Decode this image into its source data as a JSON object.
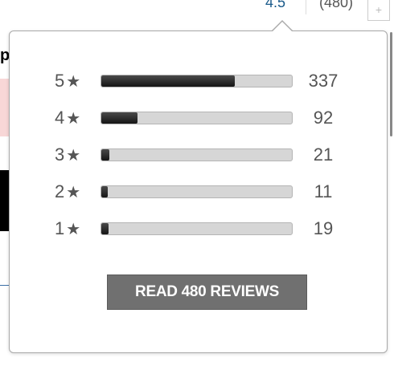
{
  "header": {
    "rating": "4.5",
    "review_count": "(480)",
    "plus_icon": "plus-icon"
  },
  "background": {
    "fragment_letter": "p"
  },
  "histogram": {
    "star_glyph": "★",
    "rows": [
      {
        "stars": "5",
        "count": "337",
        "fraction": 0.7021
      },
      {
        "stars": "4",
        "count": "92",
        "fraction": 0.1917
      },
      {
        "stars": "3",
        "count": "21",
        "fraction": 0.0438
      },
      {
        "stars": "2",
        "count": "11",
        "fraction": 0.0229
      },
      {
        "stars": "1",
        "count": "19",
        "fraction": 0.0396
      }
    ]
  },
  "actions": {
    "read_reviews_label": "READ 480 REVIEWS"
  },
  "colors": {
    "bar_fill": "#1a1a1a",
    "bar_track": "#d6d6d6",
    "button": "#707070",
    "rating_link": "#1a5a8a"
  }
}
